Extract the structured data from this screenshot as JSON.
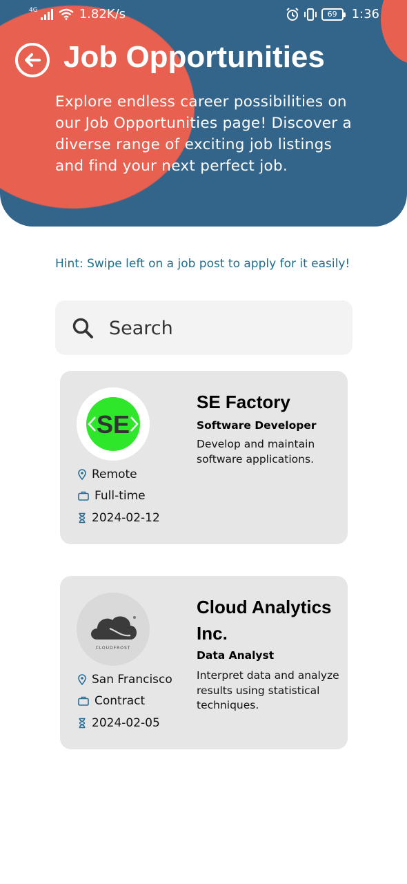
{
  "status_bar": {
    "network_type": "4G",
    "speed": "1.82K/s",
    "battery": "69",
    "time": "1:36"
  },
  "header": {
    "title": "Job Opportunities",
    "intro": "Explore endless career possibilities on our Job Opportunities page! Discover a diverse range of exciting job listings and find your next perfect job."
  },
  "hint": "Hint: Swipe left on a job post to apply for it easily!",
  "search": {
    "placeholder": "Search"
  },
  "jobs": [
    {
      "company": "SE Factory",
      "logo_text": "SE",
      "title": "Software Developer",
      "description": "Develop and maintain software applications.",
      "location": "Remote",
      "type": "Full-time",
      "date": "2024-02-12"
    },
    {
      "company": "Cloud Analytics Inc.",
      "logo_text": "CLOUDFROST",
      "title": "Data Analyst",
      "description": "Interpret data and analyze results using statistical techniques.",
      "location": "San Francisco",
      "type": "Contract",
      "date": "2024-02-05"
    }
  ],
  "colors": {
    "header_bg": "#33648a",
    "accent_blob": "#e8604f",
    "hint_text": "#1e6e8e",
    "card_bg": "#e6e6e6",
    "icon_blue": "#2a6e96",
    "se_logo_green": "#2ee62a"
  }
}
